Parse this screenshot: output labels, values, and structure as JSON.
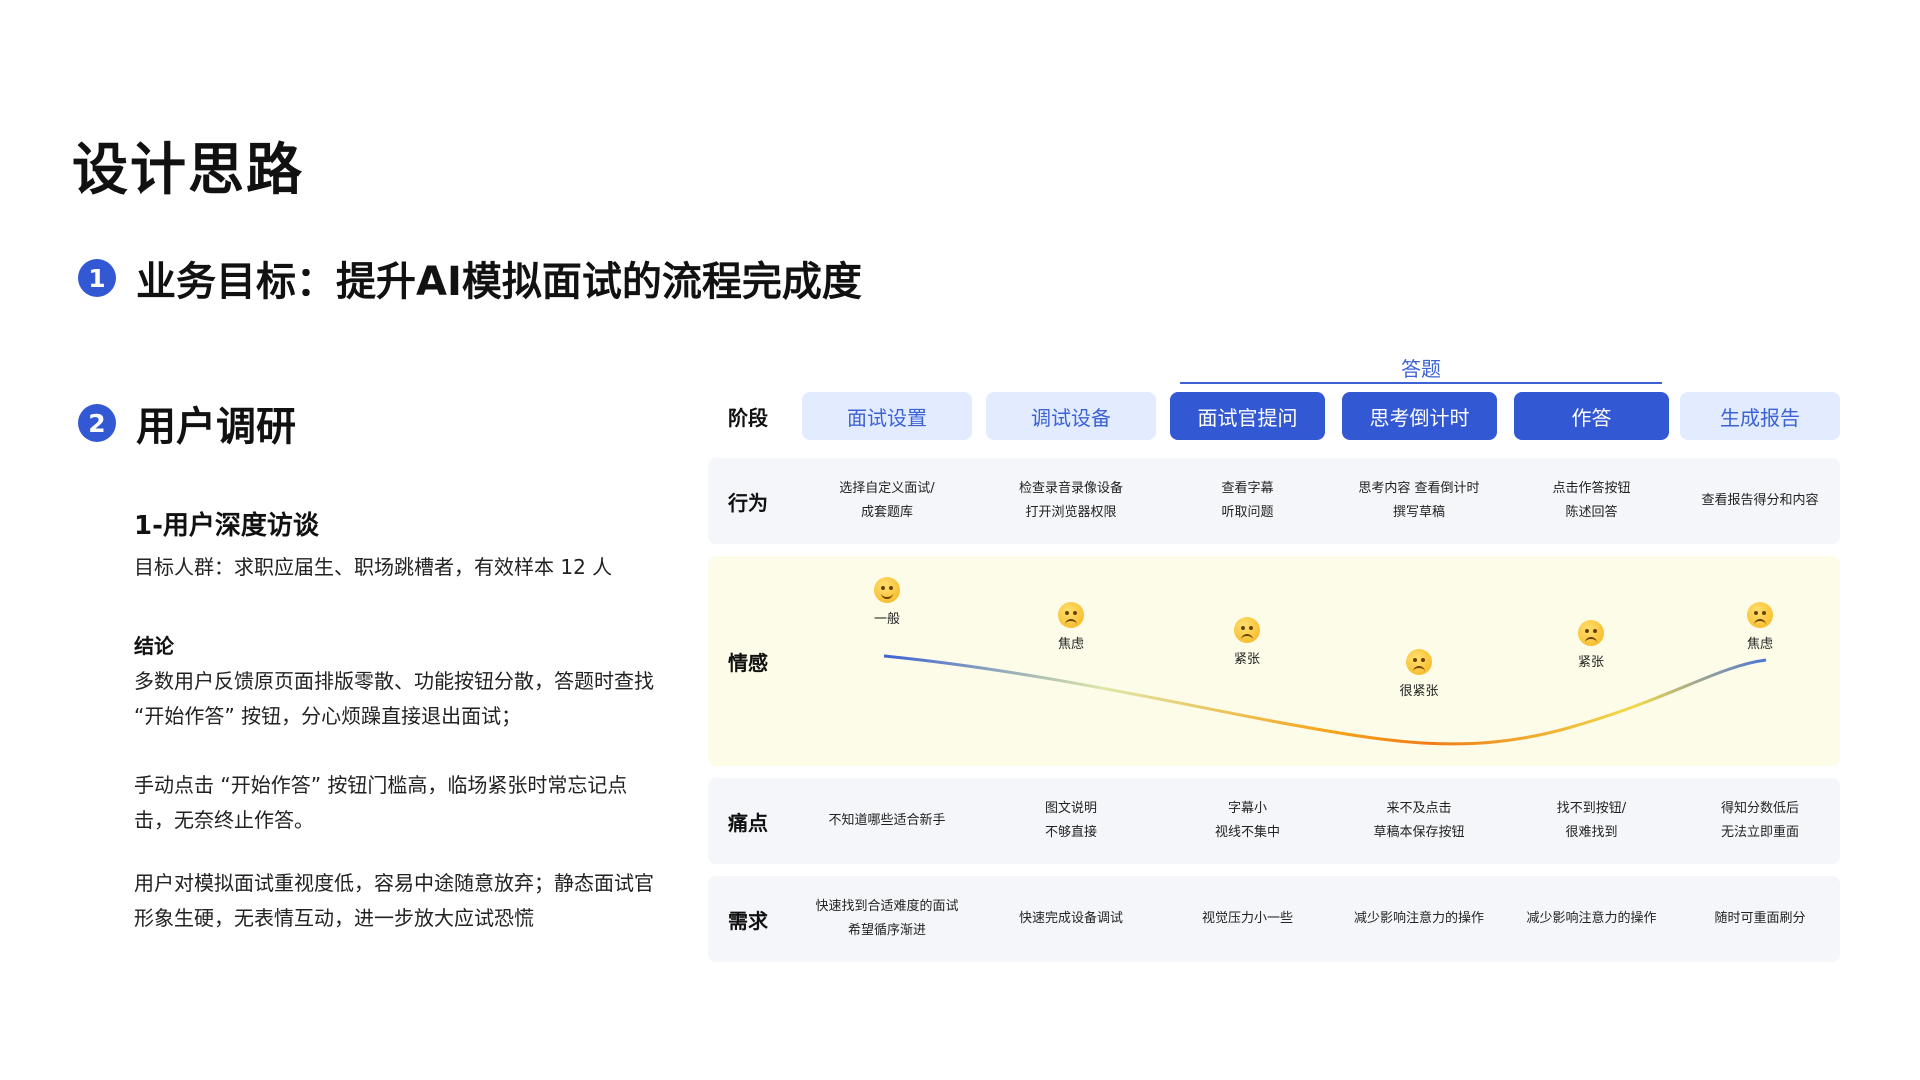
{
  "title": "设计思路",
  "section1": {
    "num": "1",
    "text": "业务目标：提升AI模拟面试的流程完成度"
  },
  "section2": {
    "num": "2",
    "text": "用户调研"
  },
  "research": {
    "subtitle": "1-用户深度访谈",
    "audience": "目标人群：求职应届生、职场跳槽者，有效样本 12 人",
    "conclusion_title": "结论",
    "paragraphs": [
      "多数用户反馈原页面排版零散、功能按钮分散，答题时查找 “开始作答” 按钮，分心烦躁直接退出面试；",
      "手动点击 “开始作答” 按钮门槛高，临场紧张时常忘记点击，无奈终止作答。",
      "用户对模拟面试重视度低，容易中途随意放弃；静态面试官形象生硬，无表情互动，进一步放大应试恐慌"
    ]
  },
  "journey": {
    "group_label": "答题",
    "stage_header": "阶段",
    "stages": [
      "面试设置",
      "调试设备",
      "面试官提问",
      "思考倒计时",
      "作答",
      "生成报告"
    ],
    "row_labels": {
      "behavior": "行为",
      "emotion": "情感",
      "pain": "痛点",
      "need": "需求"
    },
    "behavior": [
      "选择自定义面试/\n成套题库",
      "检查录音录像设备\n打开浏览器权限",
      "查看字幕\n听取问题",
      "思考内容 查看倒计时\n撰写草稿",
      "点击作答按钮\n陈述回答",
      "查看报告得分和内容"
    ],
    "emotions": [
      {
        "label": "一般",
        "icon": "slightly-smiling-face-icon",
        "level": 0.92
      },
      {
        "label": "焦虑",
        "icon": "anxious-face-icon",
        "level": 0.72
      },
      {
        "label": "紧张",
        "icon": "tense-face-icon",
        "level": 0.6
      },
      {
        "label": "很紧张",
        "icon": "very-tense-face-icon",
        "level": 0.35
      },
      {
        "label": "紧张",
        "icon": "tense-face-icon",
        "level": 0.58
      },
      {
        "label": "焦虑",
        "icon": "anxious-face-icon",
        "level": 0.72
      }
    ],
    "pain": [
      "不知道哪些适合新手",
      "图文说明\n不够直接",
      "字幕小\n视线不集中",
      "来不及点击\n草稿本保存按钮",
      "找不到按钮/\n很难找到",
      "得知分数低后\n无法立即重面"
    ],
    "need": [
      "快速找到合适难度的面试\n希望循序渐进",
      "快速完成设备调试",
      "视觉压力小一些",
      "减少影响注意力的操作",
      "减少影响注意力的操作",
      "随时可重面刷分"
    ]
  },
  "colors": {
    "accent": "#3358d4",
    "light_stage": "#e2ebff",
    "row_bg": "#f4f6f9",
    "emotion_bg": "#fdfce8"
  }
}
